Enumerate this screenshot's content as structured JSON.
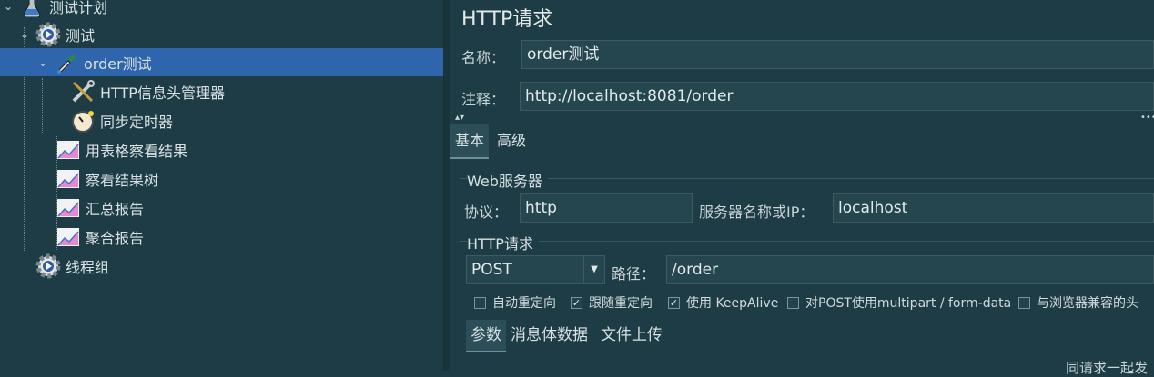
{
  "tree": {
    "items": [
      {
        "label": "测试计划"
      },
      {
        "label": "测试"
      },
      {
        "label": "order测试"
      },
      {
        "label": "HTTP信息头管理器"
      },
      {
        "label": "同步定时器"
      },
      {
        "label": "用表格察看结果"
      },
      {
        "label": "察看结果树"
      },
      {
        "label": "汇总报告"
      },
      {
        "label": "聚合报告"
      },
      {
        "label": "线程组"
      }
    ]
  },
  "panel": {
    "title": "HTTP请求",
    "name_label": "名称：",
    "name_value": "order测试",
    "comment_label": "注释：",
    "comment_value": "http://localhost:8081/order",
    "tabs": [
      "基本",
      "高级"
    ],
    "web_server": {
      "title": "Web服务器",
      "protocol_label": "协议：",
      "protocol_value": "http",
      "server_label": "服务器名称或IP：",
      "server_value": "localhost"
    },
    "http_request": {
      "title": "HTTP请求",
      "method": "POST",
      "path_label": "路径：",
      "path_value": "/order"
    },
    "options": [
      {
        "label": "自动重定向",
        "checked": false
      },
      {
        "label": "跟随重定向",
        "checked": true
      },
      {
        "label": "使用 KeepAlive",
        "checked": true
      },
      {
        "label": "对POST使用multipart / form-data",
        "checked": false
      },
      {
        "label": "与浏览器兼容的头",
        "checked": false
      }
    ],
    "check_mark": "✓",
    "subtabs": [
      "参数",
      "消息体数据",
      "文件上传"
    ],
    "bottom_text": "同请求一起发"
  }
}
